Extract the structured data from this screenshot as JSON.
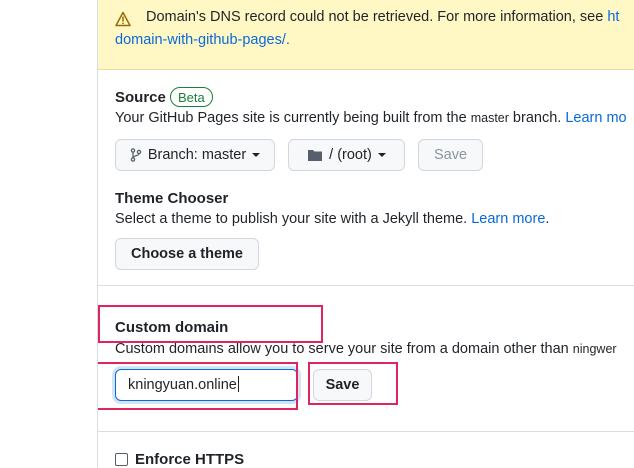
{
  "flash": {
    "message_prefix": "Domain's DNS record could not be retrieved. For more information, see ",
    "link_start": "ht",
    "link_rest": "domain-with-github-pages/."
  },
  "source": {
    "title": "Source",
    "badge": "Beta",
    "desc_prefix": "Your GitHub Pages site is currently being built from the ",
    "branch_name": "master",
    "desc_suffix": " branch. ",
    "learn_more": "Learn mo",
    "branch_button": "Branch: master",
    "folder_button": "/ (root)",
    "save_button": "Save"
  },
  "theme": {
    "title": "Theme Chooser",
    "desc_prefix": "Select a theme to publish your site with a Jekyll theme. ",
    "learn_more": "Learn more",
    "desc_suffix": ".",
    "button": "Choose a theme"
  },
  "custom_domain": {
    "title": "Custom domain",
    "desc_prefix": "Custom domains allow you to serve your site from a domain other than ",
    "desc_mono": "ningwer",
    "input_value": "kningyuan.online",
    "save_button": "Save"
  },
  "https": {
    "label": "Enforce HTTPS",
    "checked": false
  },
  "colors": {
    "link": "#0969da",
    "flash_bg": "#fff8c5",
    "badge": "#1a7f37",
    "highlight": "#e0245e"
  }
}
